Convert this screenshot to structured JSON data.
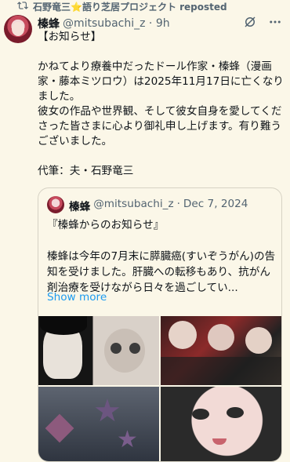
{
  "repost": {
    "text": "石野竜三⭐語り芝居プロジェクト reposted",
    "icon": "repost-icon"
  },
  "tweet": {
    "author_name": "榛蜂",
    "handle": "@mitsubachi_z",
    "time": "9h",
    "body": "【お知らせ】\n\nかねてより療養中だったドール作家・榛蜂（漫画家・藤本ミツロウ）は2025年11月17日に亡くなりました。\n彼女の作品や世界観、そして彼女自身を愛してくださった皆さまに心より御礼申し上げます。有り難うございました。\n\n代筆：夫・石野竜三",
    "icons": [
      "grok-icon",
      "more-icon"
    ]
  },
  "quote": {
    "author_name": "榛蜂",
    "handle": "@mitsubachi_z",
    "date": "Dec 7, 2024",
    "body": "『榛蜂からのお知らせ』\n\n榛蜂は今年の7月末に膵臓癌(すいぞうがん)の告知を受けました。肝臓への転移もあり、抗がん剤治療を受けながら日々を過ごしてい...",
    "show_more": "Show more"
  }
}
